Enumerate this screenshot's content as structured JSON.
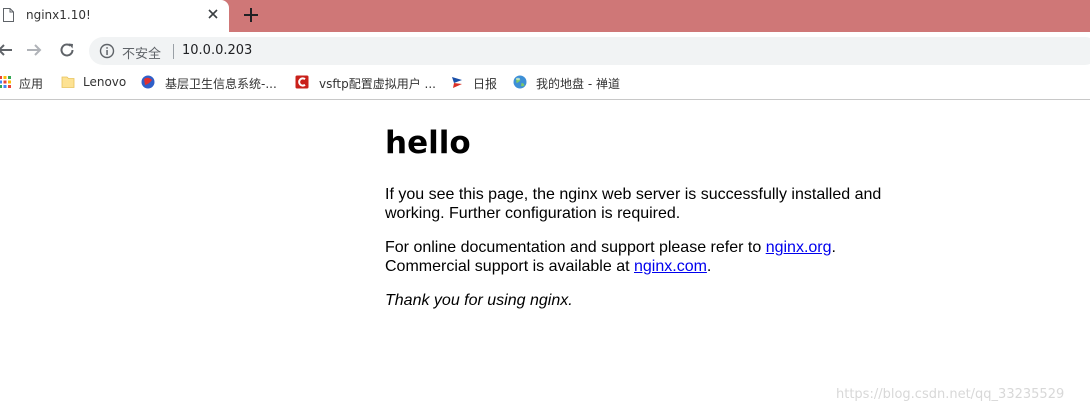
{
  "tab": {
    "title": "nginx1.10!",
    "close_icon": "close-icon",
    "page_icon": "page-icon"
  },
  "new_tab": {
    "icon": "plus-icon"
  },
  "toolbar": {
    "security_label": "不安全",
    "url": "10.0.0.203"
  },
  "bookmarks": [
    {
      "label": "应用",
      "icon": "apps-grid-icon"
    },
    {
      "label": "Lenovo",
      "icon": "folder-icon"
    },
    {
      "label": "基层卫生信息系统-...",
      "icon": "globe-red-icon"
    },
    {
      "label": "vsftp配置虚拟用户 ...",
      "icon": "csdn-icon"
    },
    {
      "label": "日报",
      "icon": "report-icon"
    },
    {
      "label": "我的地盘 - 禅道",
      "icon": "globe-icon"
    }
  ],
  "page": {
    "heading": "hello",
    "p1": "If you see this page, the nginx web server is successfully installed and working. Further configuration is required.",
    "p2_pre": "For online documentation and support please refer to ",
    "p2_link1": "nginx.org",
    "p2_mid": ".",
    "p2_pre2": "Commercial support is available at ",
    "p2_link2": "nginx.com",
    "p2_end": ".",
    "p3": "Thank you for using nginx."
  },
  "watermark": "https://blog.csdn.net/qq_33235529",
  "colors": {
    "tabstrip": "#cf7777",
    "omnibox": "#f1f3f4",
    "link": "#0000ee"
  }
}
